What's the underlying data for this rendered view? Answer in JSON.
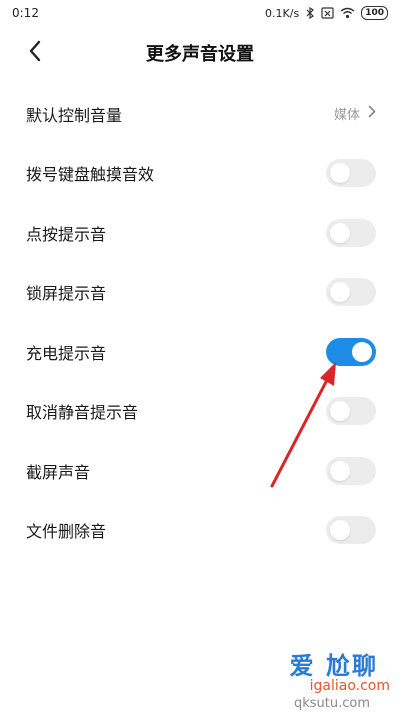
{
  "status_bar": {
    "time": "0:12",
    "network_speed": "0.1K/s",
    "battery": "100"
  },
  "header": {
    "title": "更多声音设置"
  },
  "settings": [
    {
      "label": "默认控制音量",
      "type": "link",
      "value": "媒体"
    },
    {
      "label": "拨号键盘触摸音效",
      "type": "toggle",
      "on": false
    },
    {
      "label": "点按提示音",
      "type": "toggle",
      "on": false
    },
    {
      "label": "锁屏提示音",
      "type": "toggle",
      "on": false
    },
    {
      "label": "充电提示音",
      "type": "toggle",
      "on": true
    },
    {
      "label": "取消静音提示音",
      "type": "toggle",
      "on": false
    },
    {
      "label": "截屏声音",
      "type": "toggle",
      "on": false
    },
    {
      "label": "文件删除音",
      "type": "toggle",
      "on": false
    }
  ],
  "watermark": {
    "title": "爱 尬聊",
    "url": "igaliao.com",
    "url2": "qksutu.com"
  },
  "colors": {
    "accent": "#1e8be6",
    "toggle_off": "#ececec",
    "annotation_arrow": "#d9262a"
  },
  "icons": {
    "back": "chevron-left-icon",
    "row_arrow": "chevron-right-icon"
  }
}
